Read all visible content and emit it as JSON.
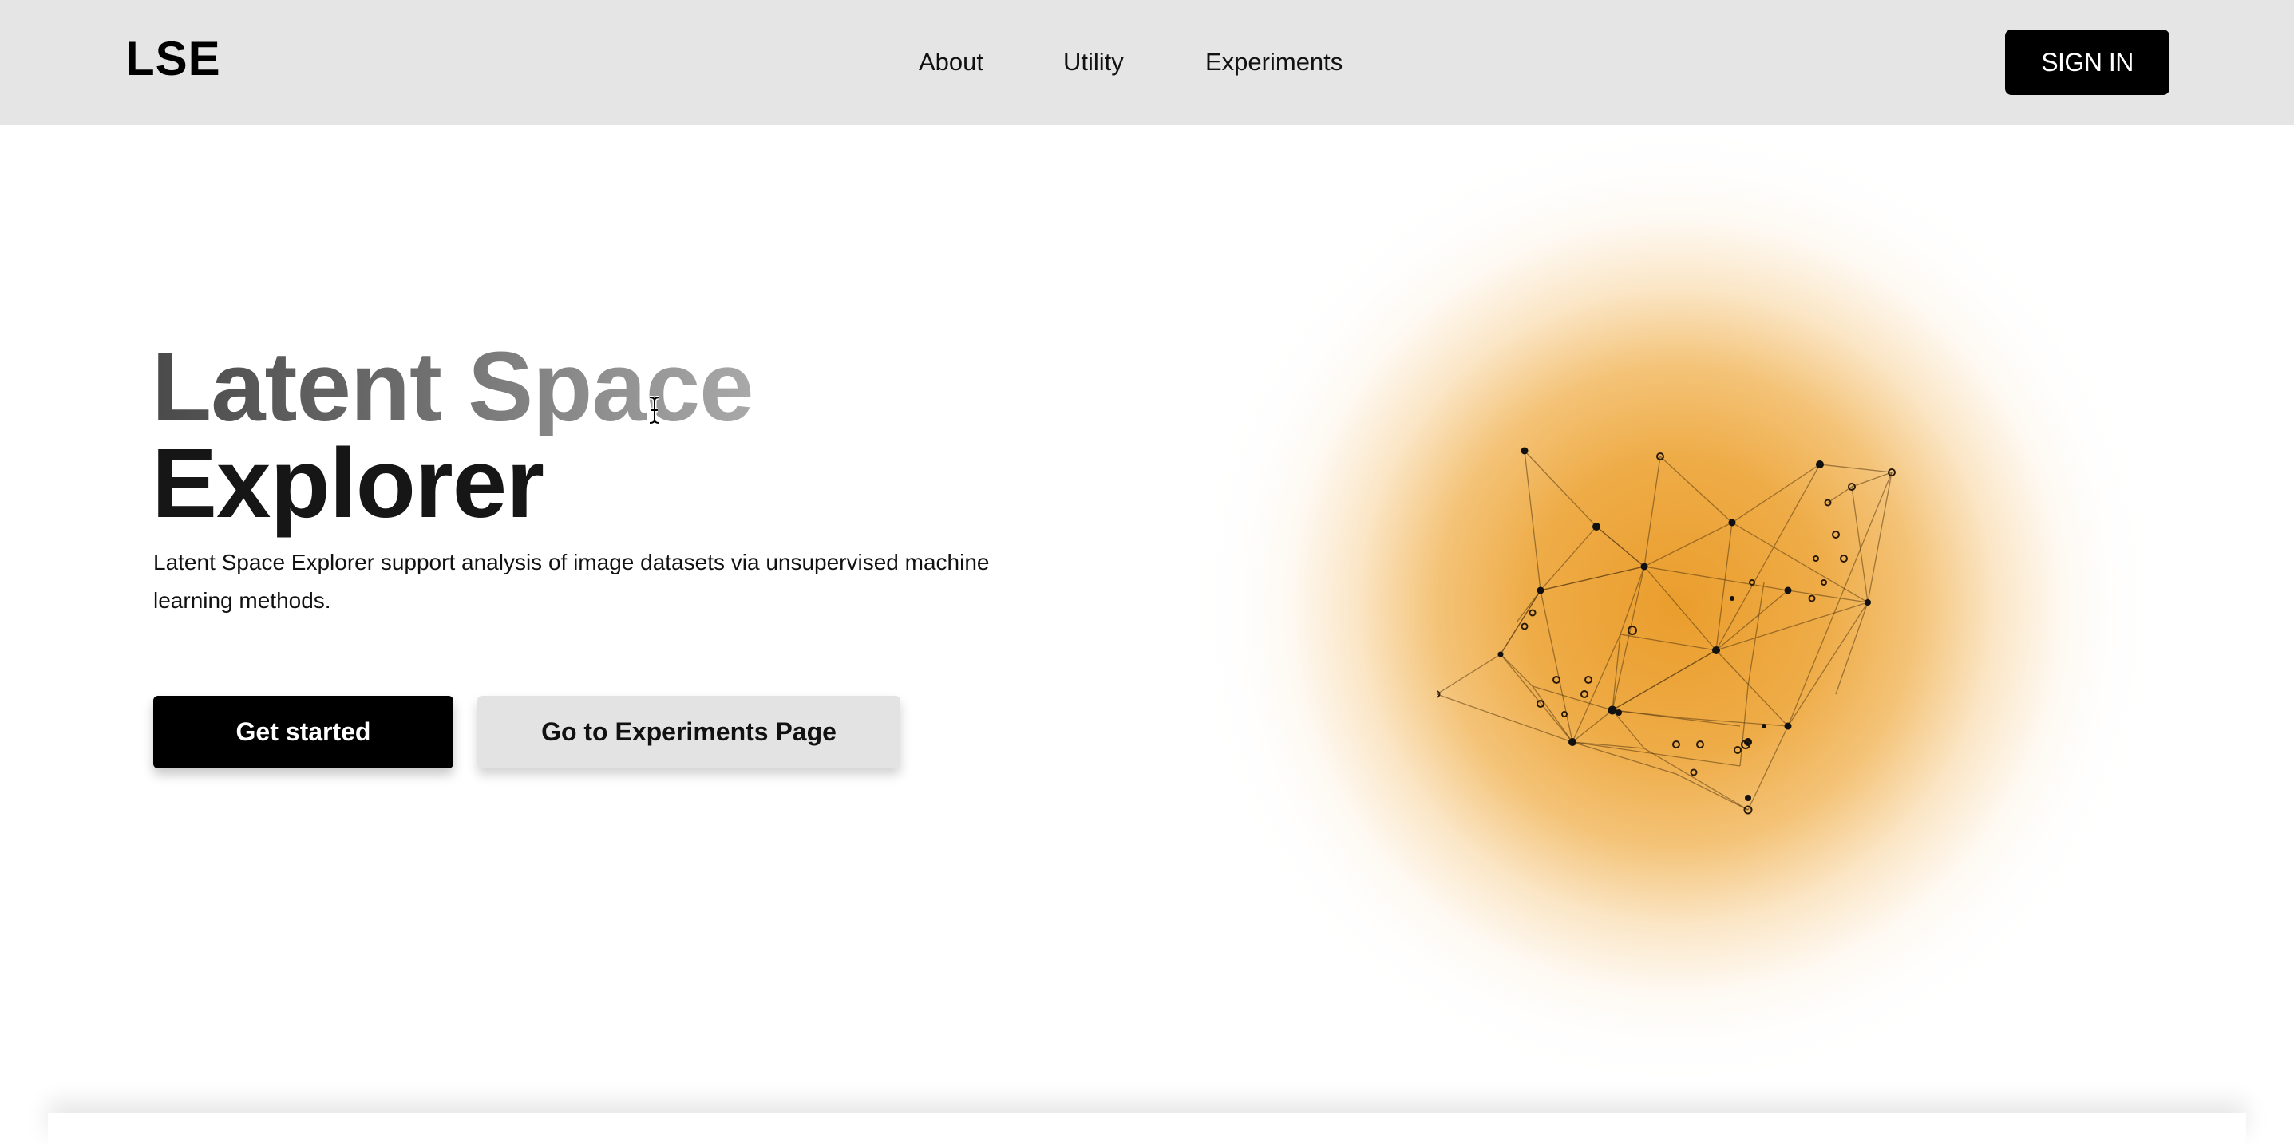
{
  "header": {
    "logo": "LSE",
    "nav": [
      {
        "label": "About"
      },
      {
        "label": "Utility"
      },
      {
        "label": "Experiments"
      }
    ],
    "signin_label": "SIGN IN"
  },
  "hero": {
    "title_line1": "Latent Space",
    "title_line2": "Explorer",
    "description": "Latent Space Explorer support analysis of image datasets via unsupervised machine learning methods.",
    "primary_button": "Get started",
    "secondary_button": "Go to Experiments Page"
  },
  "colors": {
    "header_bg": "#e5e5e5",
    "accent": "#e9982a",
    "button_dark": "#000000",
    "button_light": "#e3e3e3"
  },
  "icons": {
    "cursor": "text-cursor-icon"
  }
}
